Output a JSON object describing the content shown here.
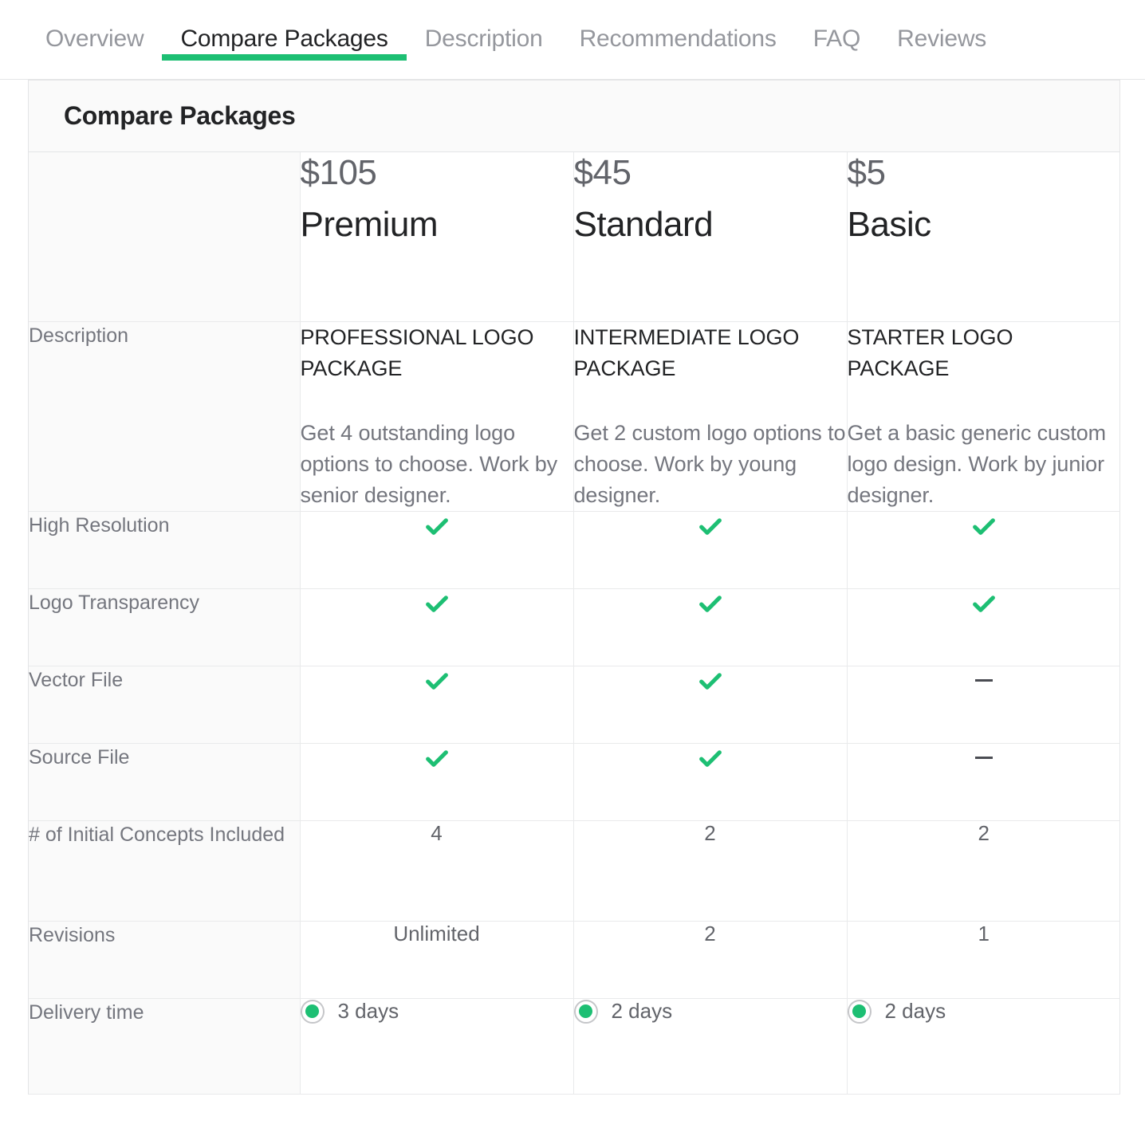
{
  "tabs": [
    {
      "label": "Overview",
      "active": false
    },
    {
      "label": "Compare Packages",
      "active": true
    },
    {
      "label": "Description",
      "active": false
    },
    {
      "label": "Recommendations",
      "active": false
    },
    {
      "label": "FAQ",
      "active": false
    },
    {
      "label": "Reviews",
      "active": false
    }
  ],
  "section": {
    "title": "Compare Packages"
  },
  "colors": {
    "accent_green": "#1dbf73",
    "label_gray": "#74767e",
    "value_gray": "#62646a",
    "heading_black": "#222325",
    "row_bg": "#fafafa",
    "border": "#e9eaeb"
  },
  "packages": [
    {
      "price": "$105",
      "name": "Premium",
      "desc_heading": "PROFESSIONAL LOGO PACKAGE",
      "desc_body": "Get 4 outstanding logo options to choose. Work by senior designer.",
      "delivery": "3 days"
    },
    {
      "price": "$45",
      "name": "Standard",
      "desc_heading": "INTERMEDIATE LOGO PACKAGE",
      "desc_body": "Get 2 custom logo options to choose. Work by young designer.",
      "delivery": "2 days"
    },
    {
      "price": "$5",
      "name": "Basic",
      "desc_heading": "STARTER LOGO PACKAGE",
      "desc_body": "Get a basic generic custom logo design. Work by junior designer.",
      "delivery": "2 days"
    }
  ],
  "rows": {
    "description_label": "Description",
    "high_resolution_label": "High Resolution",
    "logo_transparency_label": "Logo Transparency",
    "vector_file_label": "Vector File",
    "source_file_label": "Source File",
    "initial_concepts_label": "# of Initial Concepts Included",
    "revisions_label": "Revisions",
    "delivery_label": "Delivery time"
  },
  "values": {
    "high_resolution": [
      "check",
      "check",
      "check"
    ],
    "logo_transparency": [
      "check",
      "check",
      "check"
    ],
    "vector_file": [
      "check",
      "check",
      "dash"
    ],
    "source_file": [
      "check",
      "check",
      "dash"
    ],
    "initial_concepts": [
      "4",
      "2",
      "2"
    ],
    "revisions": [
      "Unlimited",
      "2",
      "1"
    ]
  },
  "icons": {
    "check": "check-icon",
    "dash": "dash-icon",
    "radio_selected": "radio-selected-icon"
  }
}
